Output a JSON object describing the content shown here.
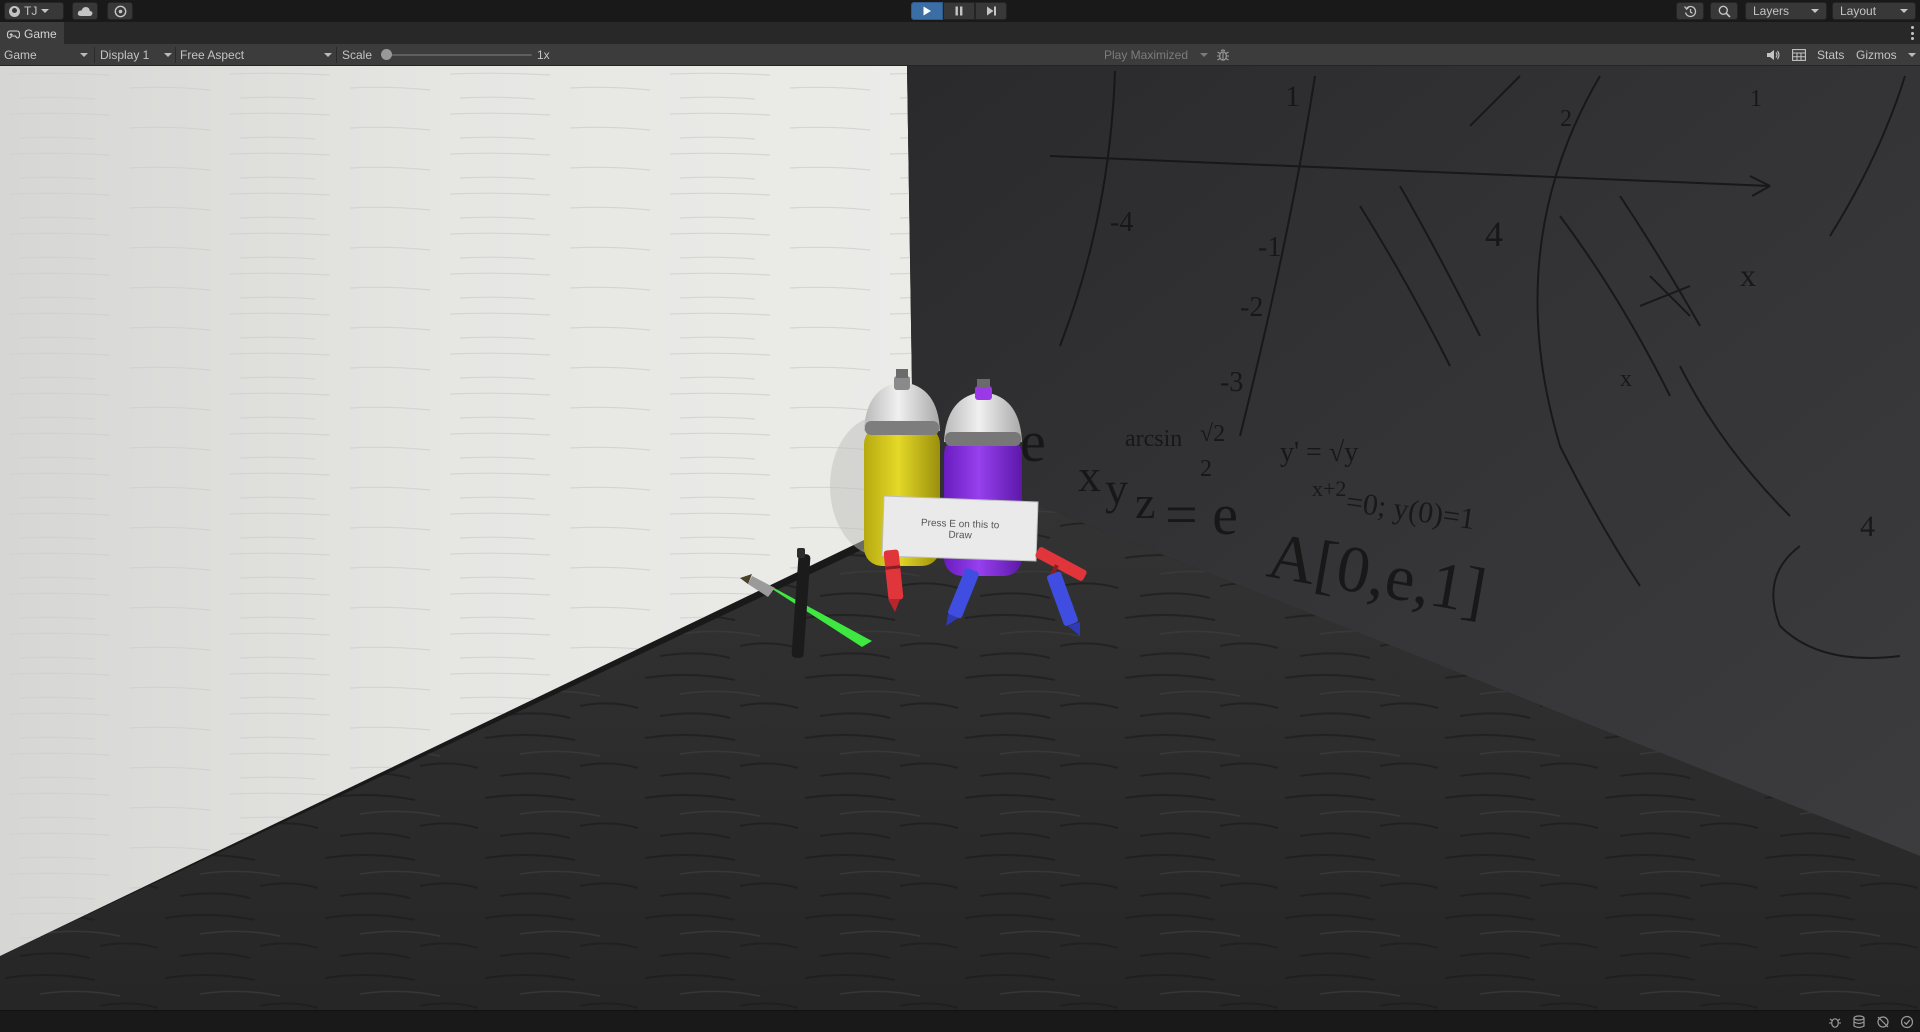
{
  "toolbar": {
    "account_label": "TJ",
    "layers_label": "Layers",
    "layout_label": "Layout",
    "play_state": "playing"
  },
  "tab": {
    "title": "Game"
  },
  "game_bar": {
    "view_select": "Game",
    "display_select": "Display 1",
    "aspect_select": "Free Aspect",
    "scale_label": "Scale",
    "scale_value": "1x",
    "scale_fraction": 0.0,
    "play_mode_select": "Play Maximized",
    "stats_label": "Stats",
    "gizmos_label": "Gizmos"
  },
  "scene": {
    "sign_text_line1": "Press E on this to",
    "sign_text_line2": "Draw",
    "chalk_text_1": "e",
    "chalk_text_2": "x",
    "chalk_text_3": "y",
    "chalk_text_4": "z",
    "chalk_text_5": "= e",
    "chalk_text_6": "A[0,e,1]",
    "chalk_text_7": "arcsin",
    "chalk_text_8": "√2",
    "chalk_text_9": "2",
    "chalk_text_10": "y' = √y",
    "chalk_text_11": "x+2",
    "chalk_text_12": "=0; y(0)=1",
    "chalk_axis_1": "1",
    "chalk_axis_2": "-1",
    "chalk_axis_3": "-2",
    "chalk_axis_4": "-3",
    "chalk_axis_5": "-4",
    "chalk_axis_6": "4",
    "chalk_axis_7": "x",
    "chalk_axis_8": "2",
    "chalk_axis_9": "1",
    "chalk_axis_10": "x",
    "chalk_axis_11": "4"
  },
  "colors": {
    "play_active": "#3a6ea5",
    "white_wall": "#e6e6e4",
    "chalk_wall": "#2f2f31",
    "floor": "#2a2a2a",
    "yellow_can": "#d8cc1e",
    "purple_can": "#8a2ee0",
    "crayon_red": "#e0353a",
    "crayon_blue": "#3f4ee0",
    "brush_green": "#3ee840"
  }
}
